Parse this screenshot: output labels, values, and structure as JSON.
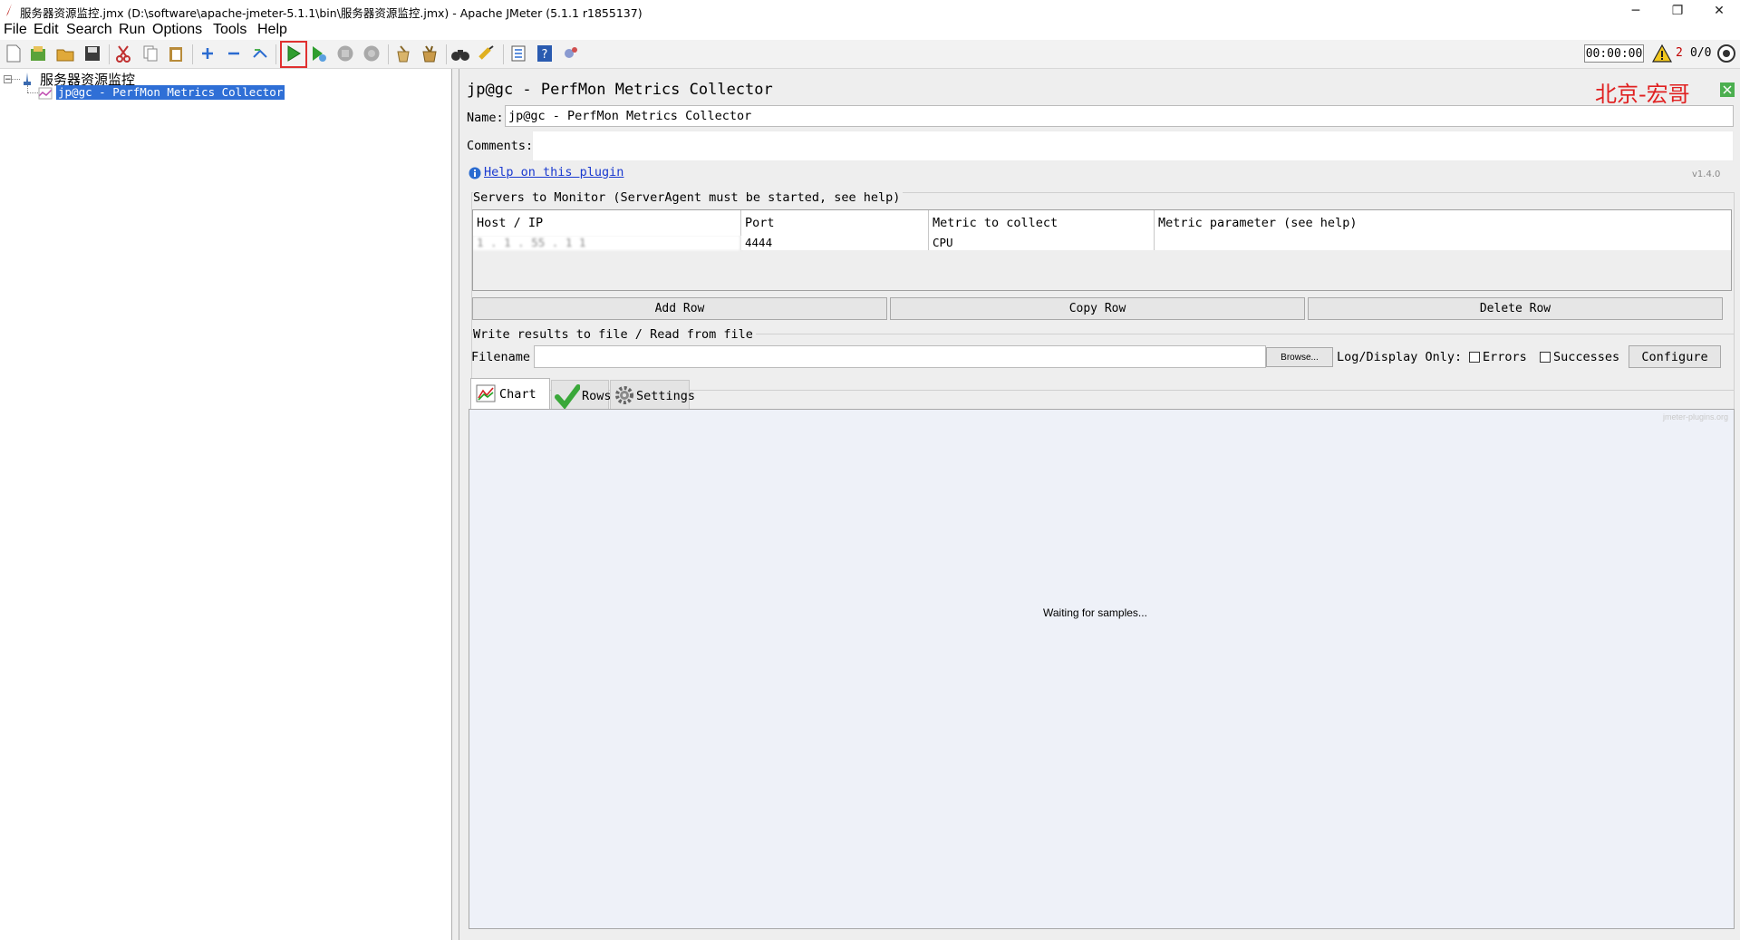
{
  "window": {
    "title": "服务器资源监控.jmx (D:\\software\\apache-jmeter-5.1.1\\bin\\服务器资源监控.jmx) - Apache JMeter (5.1.1 r1855137)",
    "controls": {
      "minimize": "─",
      "restore": "❐",
      "close": "✕"
    }
  },
  "menubar": {
    "items": [
      {
        "label": "File"
      },
      {
        "label": "Edit"
      },
      {
        "label": "Search"
      },
      {
        "label": "Run"
      },
      {
        "label": "Options"
      },
      {
        "label": "Tools"
      },
      {
        "label": "Help"
      }
    ]
  },
  "toolbar": {
    "timer": "00:00:00",
    "error_count": "2",
    "thread_count": "0/0",
    "icons": [
      "new-icon",
      "templates-icon",
      "open-icon",
      "save-icon",
      "cut-icon",
      "copy-icon",
      "paste-icon",
      "expand-icon",
      "collapse-icon",
      "toggle-icon",
      "start-icon",
      "start-no-pauses-icon",
      "stop-icon",
      "shutdown-icon",
      "clear-icon",
      "clear-all-icon",
      "search-icon",
      "reset-search-icon",
      "function-helper-icon",
      "help-icon",
      "remote-icon"
    ]
  },
  "tree": {
    "root_label": "服务器资源监控",
    "child_label": "jp@gc - PerfMon Metrics Collector"
  },
  "panel": {
    "title": "jp@gc - PerfMon Metrics Collector",
    "watermark": "北京-宏哥",
    "name_label": "Name:",
    "name_value": "jp@gc - PerfMon Metrics Collector",
    "comments_label": "Comments:",
    "comments_value": "",
    "help_link": "Help on this plugin",
    "version": "v1.4.0"
  },
  "servers": {
    "section_title": "Servers to Monitor (ServerAgent must be started, see help)",
    "columns": [
      "Host / IP",
      "Port",
      "Metric to collect",
      "Metric parameter (see help)"
    ],
    "rows": [
      {
        "host": "1 . 1 . 55 . 1 1",
        "port": "4444",
        "metric": "CPU",
        "parameter": ""
      }
    ],
    "buttons": {
      "add": "Add Row",
      "copy": "Copy Row",
      "delete": "Delete Row"
    }
  },
  "file": {
    "section_title": "Write results to file / Read from file",
    "filename_label": "Filename",
    "filename_value": "",
    "browse": "Browse...",
    "log_display_label": "Log/Display Only:",
    "errors_label": "Errors",
    "successes_label": "Successes",
    "configure": "Configure"
  },
  "tabs": [
    {
      "label": "Chart",
      "icon": "chart-icon",
      "selected": true
    },
    {
      "label": "Rows",
      "icon": "checkmark-icon",
      "selected": false
    },
    {
      "label": "Settings",
      "icon": "gear-icon",
      "selected": false
    }
  ],
  "chart": {
    "status": "Waiting for samples...",
    "credit": "jmeter-plugins.org"
  }
}
